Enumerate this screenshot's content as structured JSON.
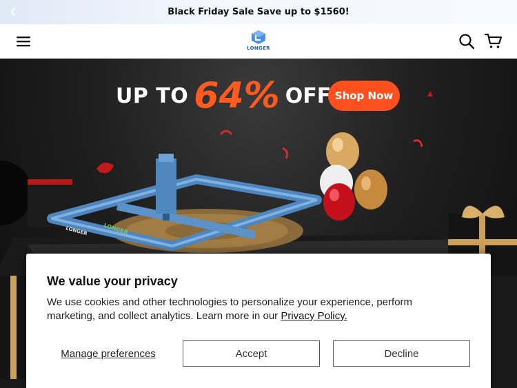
{
  "announcement": {
    "text": "Black Friday Sale Save up to $1560!",
    "prev_icon": "chevron-left-icon"
  },
  "header": {
    "menu_icon": "hamburger-menu-icon",
    "logo_text": "LONGER",
    "search_icon": "search-icon",
    "cart_icon": "cart-icon",
    "brand_color": "#1f5fb8"
  },
  "hero": {
    "prefix": "UP TO",
    "percent": "64%",
    "suffix": "OFF",
    "cta_label": "Shop Now",
    "accent_color": "#ff4f1f",
    "product_label_1": "LONGER",
    "product_label_2": "LONGER"
  },
  "consent": {
    "title": "We value your privacy",
    "body": "We use cookies and other technologies to personalize your experience, perform marketing, and collect analytics. Learn more in our ",
    "link_text": "Privacy Policy.",
    "manage_label": "Manage preferences",
    "accept_label": "Accept",
    "decline_label": "Decline"
  }
}
